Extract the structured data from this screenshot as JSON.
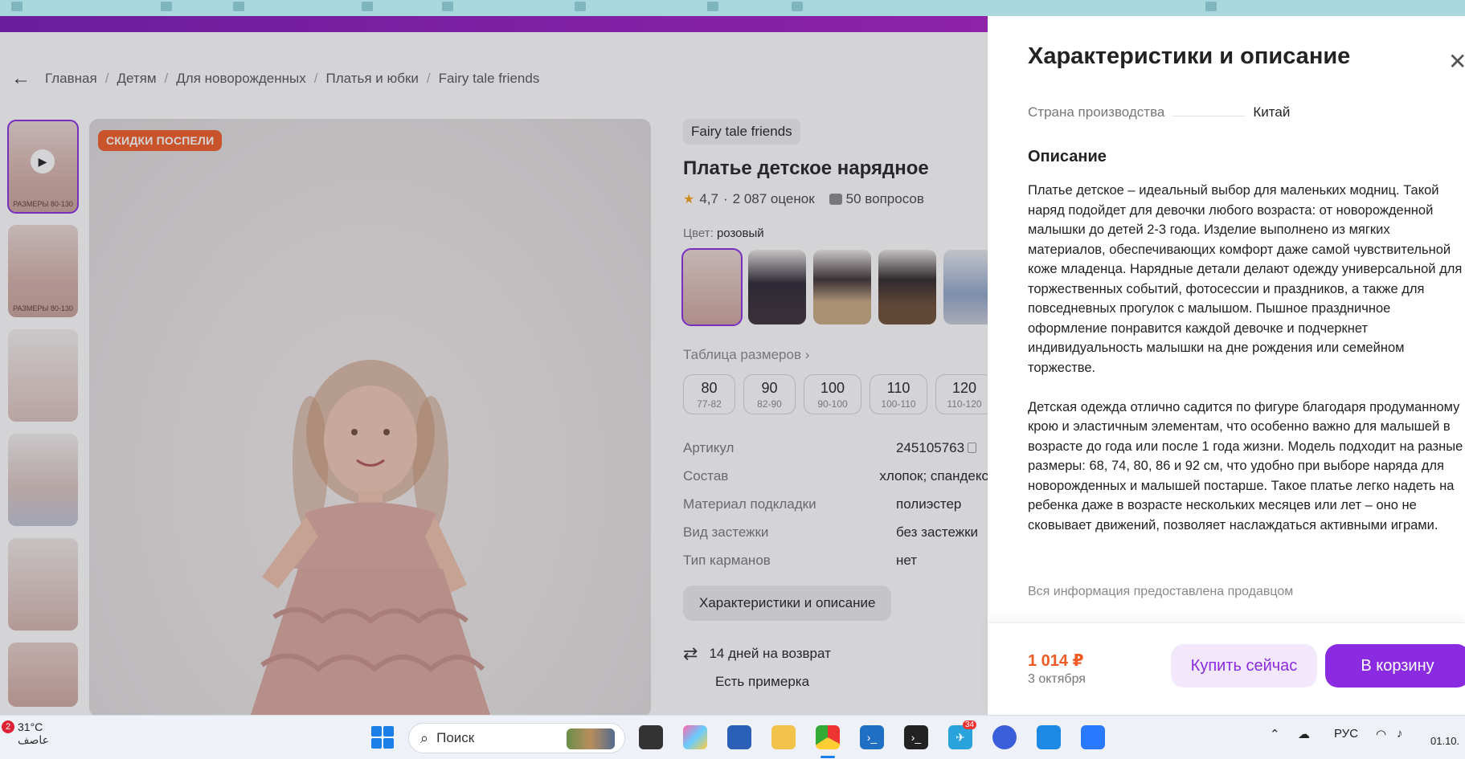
{
  "breadcrumb": {
    "items": [
      "Главная",
      "Детям",
      "Для новорожденных",
      "Платья и юбки",
      "Fairy tale friends"
    ]
  },
  "thumbnails": {
    "caption": "РАЗМЕРЫ 80-130"
  },
  "main_photo": {
    "badge": "СКИДКИ ПОСПЕЛИ"
  },
  "product": {
    "brand": "Fairy tale friends",
    "title": "Платье детское нарядное",
    "rating": "4,7",
    "reviews": "2 087 оценок",
    "questions": "50 вопросов",
    "color_label": "Цвет:",
    "color_value": "розовый",
    "size_table_link": "Таблица размеров",
    "sizes": [
      {
        "v": "80",
        "r": "77-82"
      },
      {
        "v": "90",
        "r": "82-90"
      },
      {
        "v": "100",
        "r": "90-100"
      },
      {
        "v": "110",
        "r": "100-110"
      },
      {
        "v": "120",
        "r": "110-120"
      }
    ],
    "specs": [
      {
        "k": "Артикул",
        "v": "245105763"
      },
      {
        "k": "Состав",
        "v": "хлопок; спандекс"
      },
      {
        "k": "Материал подкладки",
        "v": "полиэстер"
      },
      {
        "k": "Вид застежки",
        "v": "без застежки"
      },
      {
        "k": "Тип карманов",
        "v": "нет"
      }
    ],
    "chars_button": "Характеристики и описание",
    "return_text": "14 дней на возврат",
    "fitting_text": "Есть примерка"
  },
  "drawer": {
    "title": "Характеристики и описание",
    "country_label": "Страна производства",
    "country_value": "Китай",
    "description_heading": "Описание",
    "description_p1": "Платье детское – идеальный выбор для маленьких модниц. Такой наряд подойдет для девочки любого возраста: от новорожденной малышки до детей 2-3 года. Изделие выполнено из мягких материалов, обеспечивающих комфорт даже самой чувствительной коже младенца. Нарядные детали делают одежду универсальной для торжественных событий, фотосессии и праздников, а также для повседневных прогулок с малышом. Пышное праздничное оформление понравится каждой девочке и подчеркнет индивидуальность малышки на дне рождения или семейном торжестве.",
    "description_p2": "Детская одежда отлично садится по фигуре благодаря продуманному крою и эластичным элементам, что особенно важно для малышей в возрасте до года или после 1 года жизни. Модель подходит на разные размеры: 68, 74, 80, 86 и 92 см, что удобно при выборе наряда для новорожденных и малышей постарше. Такое платье легко надеть на ребенка даже в возрасте нескольких месяцев или лет – оно не сковывает движений, позволяет наслаждаться активными играми.",
    "note": "Вся информация предоставлена продавцом",
    "price": "1 014 ₽",
    "date": "3 октября",
    "buy_now": "Купить сейчас",
    "to_cart": "В корзину"
  },
  "taskbar": {
    "weather_badge": "2",
    "temperature": "31°C",
    "location": "عاصف",
    "search_label": "Поиск",
    "lang": "РУС",
    "time": "01.10.",
    "telegram_badge": "34"
  },
  "colors": {
    "accent": "#8a2be2",
    "badge": "#f15a24",
    "price": "#f15a24",
    "promo_bar": "#7b1fa2"
  }
}
